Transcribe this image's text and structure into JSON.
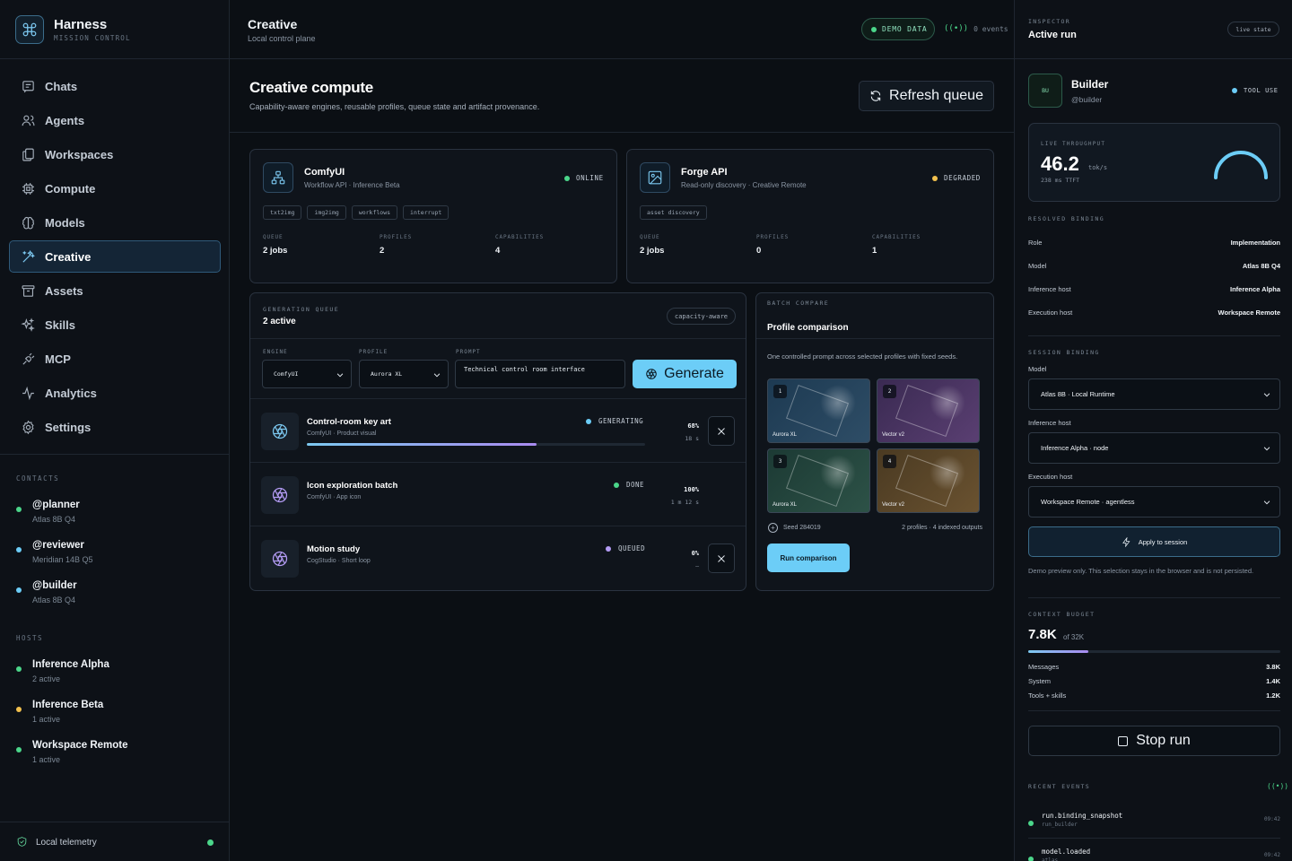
{
  "brand": {
    "name": "Harness",
    "subtitle": "MISSION CONTROL"
  },
  "nav": [
    {
      "label": "Chats",
      "icon": "chat-icon",
      "active": false
    },
    {
      "label": "Agents",
      "icon": "users-icon",
      "active": false
    },
    {
      "label": "Workspaces",
      "icon": "workspaces-icon",
      "active": false
    },
    {
      "label": "Compute",
      "icon": "cpu-icon",
      "active": false
    },
    {
      "label": "Models",
      "icon": "brain-icon",
      "active": false
    },
    {
      "label": "Creative",
      "icon": "wand-icon",
      "active": true
    },
    {
      "label": "Assets",
      "icon": "archive-icon",
      "active": false
    },
    {
      "label": "Skills",
      "icon": "sparkles-icon",
      "active": false
    },
    {
      "label": "MCP",
      "icon": "plug-icon",
      "active": false
    },
    {
      "label": "Analytics",
      "icon": "activity-icon",
      "active": false
    },
    {
      "label": "Settings",
      "icon": "gear-icon",
      "active": false
    }
  ],
  "contacts": {
    "label": "CONTACTS",
    "items": [
      {
        "name": "@planner",
        "sub": "Atlas 8B Q4",
        "color": "#4bd68a"
      },
      {
        "name": "@reviewer",
        "sub": "Meridian 14B Q5",
        "color": "#6ccdf7"
      },
      {
        "name": "@builder",
        "sub": "Atlas 8B Q4",
        "color": "#6ccdf7"
      }
    ]
  },
  "hosts": {
    "label": "HOSTS",
    "items": [
      {
        "name": "Inference Alpha",
        "sub": "2 active",
        "color": "#4bd68a"
      },
      {
        "name": "Inference Beta",
        "sub": "1 active",
        "color": "#f2c14e"
      },
      {
        "name": "Workspace Remote",
        "sub": "1 active",
        "color": "#4bd68a"
      }
    ]
  },
  "telemetry": {
    "label": "Local telemetry"
  },
  "header": {
    "title": "Creative",
    "subtitle": "Local control plane",
    "demo_badge": "DEMO DATA",
    "events": "0 events"
  },
  "page": {
    "title": "Creative compute",
    "subtitle": "Capability-aware engines, reusable profiles, queue state and artifact provenance.",
    "refresh_label": "Refresh queue"
  },
  "engines": [
    {
      "name": "ComfyUI",
      "sub": "Workflow API · Inference Beta",
      "status": "ONLINE",
      "status_color": "#4bd68a",
      "icon": "workflow-icon",
      "tags": [
        "txt2img",
        "img2img",
        "workflows",
        "interrupt"
      ],
      "stats": [
        {
          "label": "QUEUE",
          "value": "2 jobs"
        },
        {
          "label": "PROFILES",
          "value": "2"
        },
        {
          "label": "CAPABILITIES",
          "value": "4"
        }
      ]
    },
    {
      "name": "Forge API",
      "sub": "Read-only discovery · Creative Remote",
      "status": "DEGRADED",
      "status_color": "#f2c14e",
      "icon": "image-icon",
      "tags": [
        "asset discovery"
      ],
      "stats": [
        {
          "label": "QUEUE",
          "value": "2 jobs"
        },
        {
          "label": "PROFILES",
          "value": "0"
        },
        {
          "label": "CAPABILITIES",
          "value": "1"
        }
      ]
    }
  ],
  "queue": {
    "label": "GENERATION QUEUE",
    "title": "2 active",
    "chip": "capacity-aware",
    "engine_label": "ENGINE",
    "engine_value": "ComfyUI",
    "profile_label": "PROFILE",
    "profile_value": "Aurora XL",
    "prompt_label": "PROMPT",
    "prompt_value": "Technical control room interface",
    "generate_label": "Generate",
    "jobs": [
      {
        "name": "Control-room key art",
        "sub": "ComfyUI · Product visual",
        "status": "GENERATING",
        "status_color": "#6ccdf7",
        "pct": "68%",
        "progress": 0.68,
        "time": "18 s",
        "cancellable": true,
        "icon_color": "#7cc8f0"
      },
      {
        "name": "Icon exploration batch",
        "sub": "ComfyUI · App icon",
        "status": "DONE",
        "status_color": "#4bd68a",
        "pct": "100%",
        "progress": 1,
        "time": "1 m 12 s",
        "cancellable": false,
        "icon_color": "#b49cf5"
      },
      {
        "name": "Motion study",
        "sub": "CogStudio · Short loop",
        "status": "QUEUED",
        "status_color": "#b49cf5",
        "pct": "0%",
        "progress": 0,
        "time": "—",
        "cancellable": true,
        "icon_color": "#b49cf5"
      }
    ]
  },
  "compare": {
    "label": "BATCH COMPARE",
    "title": "Profile comparison",
    "desc": "One controlled prompt across selected profiles with fixed seeds.",
    "tiles": [
      {
        "num": "1",
        "label": "Aurora XL",
        "color_a": "#1d3a52",
        "color_b": "#2e4d66"
      },
      {
        "num": "2",
        "label": "Vector v2",
        "color_a": "#3a2a52",
        "color_b": "#5a3f72"
      },
      {
        "num": "3",
        "label": "Aurora XL",
        "color_a": "#1c3a34",
        "color_b": "#2d5247"
      },
      {
        "num": "4",
        "label": "Vector v2",
        "color_a": "#4a3a22",
        "color_b": "#6a5230"
      }
    ],
    "seed": "Seed 284019",
    "outputs": "2 profiles · 4 indexed outputs",
    "run_label": "Run comparison"
  },
  "inspector": {
    "label": "INSPECTOR",
    "title": "Active run",
    "live_chip": "live state",
    "agent": {
      "avatar": "BU",
      "name": "Builder",
      "handle": "@builder",
      "status": "TOOL USE"
    },
    "throughput": {
      "label": "LIVE THROUGHPUT",
      "value": "46.2",
      "unit": "tok/s",
      "ttft": "238 ms TTFT"
    },
    "resolved": {
      "label": "RESOLVED BINDING",
      "rows": [
        {
          "k": "Role",
          "v": "Implementation"
        },
        {
          "k": "Model",
          "v": "Atlas 8B Q4"
        },
        {
          "k": "Inference host",
          "v": "Inference Alpha"
        },
        {
          "k": "Execution host",
          "v": "Workspace Remote"
        }
      ]
    },
    "session": {
      "label": "SESSION BINDING",
      "model_label": "Model",
      "model_value": "Atlas 8B · Local Runtime",
      "inference_label": "Inference host",
      "inference_value": "Inference Alpha · node",
      "execution_label": "Execution host",
      "execution_value": "Workspace Remote · agentless",
      "apply_label": "Apply to session",
      "note": "Demo preview only. This selection stays in the browser and is not persisted."
    },
    "budget": {
      "label": "CONTEXT BUDGET",
      "value": "7.8K",
      "of": "of 32K",
      "fraction": 0.24,
      "rows": [
        {
          "k": "Messages",
          "v": "3.8K"
        },
        {
          "k": "System",
          "v": "1.4K"
        },
        {
          "k": "Tools + skills",
          "v": "1.2K"
        }
      ]
    },
    "stop_label": "Stop run",
    "events": {
      "label": "RECENT EVENTS",
      "items": [
        {
          "name": "run.binding_snapshot",
          "sub": "run_builder",
          "time": "09:42"
        },
        {
          "name": "model.loaded",
          "sub": "atlas",
          "time": "09:42"
        }
      ]
    }
  }
}
